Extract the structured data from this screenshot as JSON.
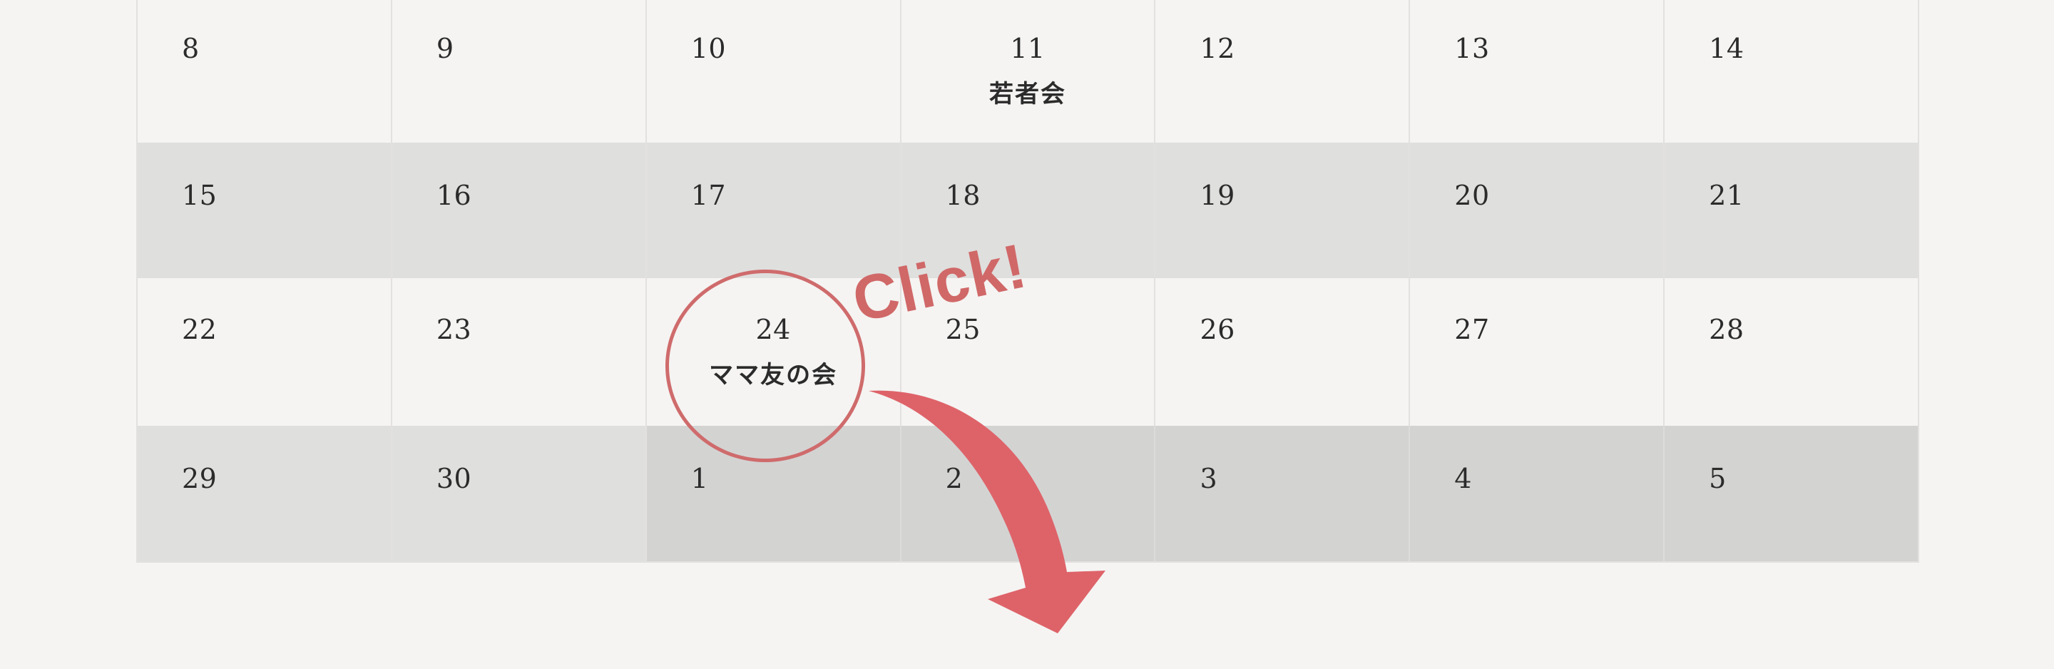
{
  "weeks": [
    [
      {
        "day": "8"
      },
      {
        "day": "9"
      },
      {
        "day": "10"
      },
      {
        "day": "11",
        "event": "若者会"
      },
      {
        "day": "12"
      },
      {
        "day": "13"
      },
      {
        "day": "14"
      }
    ],
    [
      {
        "day": "15"
      },
      {
        "day": "16"
      },
      {
        "day": "17"
      },
      {
        "day": "18"
      },
      {
        "day": "19"
      },
      {
        "day": "20"
      },
      {
        "day": "21"
      }
    ],
    [
      {
        "day": "22"
      },
      {
        "day": "23"
      },
      {
        "day": "24",
        "event": "ママ友の会"
      },
      {
        "day": "25"
      },
      {
        "day": "26"
      },
      {
        "day": "27"
      },
      {
        "day": "28"
      }
    ],
    [
      {
        "day": "29"
      },
      {
        "day": "30"
      },
      {
        "day": "1",
        "other_month": true
      },
      {
        "day": "2",
        "other_month": true
      },
      {
        "day": "3",
        "other_month": true
      },
      {
        "day": "4",
        "other_month": true
      },
      {
        "day": "5",
        "other_month": true
      }
    ]
  ],
  "annotation": {
    "label": "Click!",
    "color": "#d06868",
    "arrow_color": "#de6369",
    "arrow_icon": "curved-arrow-down-icon"
  }
}
